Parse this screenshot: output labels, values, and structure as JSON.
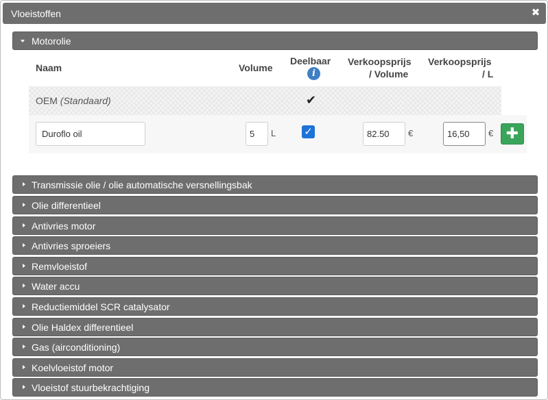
{
  "window": {
    "title": "Vloeistoffen",
    "close_glyph": "✖"
  },
  "motorolie": {
    "header": "Motorolie",
    "columns": {
      "naam": "Naam",
      "volume": "Volume",
      "deelbaar": "Deelbaar",
      "prijs_volume_1": "Verkoopsprijs",
      "prijs_volume_2": "/ Volume",
      "prijs_liter_1": "Verkoopsprijs",
      "prijs_liter_2": "/ L"
    },
    "info_glyph": "i",
    "oem_row": {
      "name": "OEM",
      "name_suffix": "(Standaard)",
      "deelbaar_glyph": "✔"
    },
    "edit_row": {
      "name_value": "Duroflo oil",
      "volume_value": "5",
      "volume_unit": "L",
      "deelbaar_checked_glyph": "✓",
      "price_volume_value": "82.50",
      "price_volume_unit": "€",
      "price_liter_value": "16,50",
      "price_liter_unit": "€",
      "add_glyph": "✚"
    }
  },
  "sections": [
    "Transmissie olie / olie automatische versnellingsbak",
    "Olie differentieel",
    "Antivries motor",
    "Antivries sproeiers",
    "Remvloeistof",
    "Water accu",
    "Reductiemiddel SCR catalysator",
    "Olie Haldex differentieel",
    "Gas (airconditioning)",
    "Koelvloeistof motor",
    "Vloeistof stuurbekrachtiging"
  ],
  "colors": {
    "bar": "#6e6e6e",
    "checkbox": "#1e73d6",
    "add_button": "#3aa55a",
    "info_icon": "#3f7fc4"
  }
}
